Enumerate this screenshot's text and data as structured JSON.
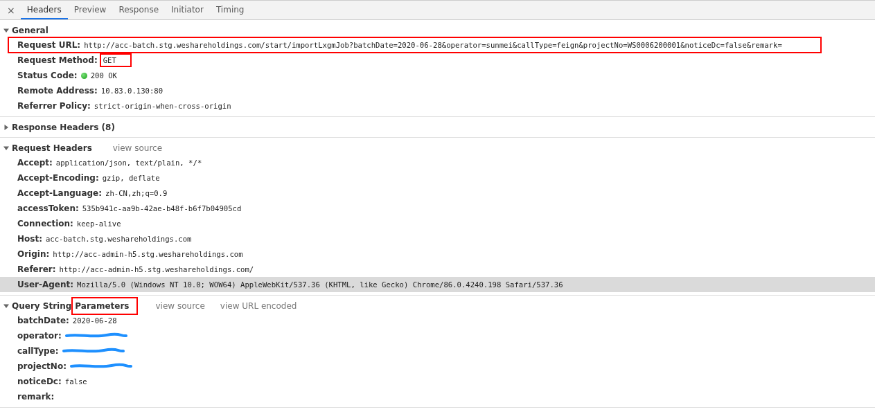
{
  "tabs": [
    {
      "label": "Headers",
      "selected": true
    },
    {
      "label": "Preview",
      "selected": false
    },
    {
      "label": "Response",
      "selected": false
    },
    {
      "label": "Initiator",
      "selected": false
    },
    {
      "label": "Timing",
      "selected": false
    }
  ],
  "close_button": "×",
  "sections": [
    {
      "title_parts": [
        {
          "text": "General",
          "highlighted": false
        }
      ],
      "expanded": true,
      "rows": [
        {
          "key": "Request URL:",
          "value": "http://acc-batch.stg.weshareholdings.com/start/importLxgmJob?batchDate=2020-06-28&operator=sunmei&callType=feign&projectNo=WS0006200001&noticeDc=false&remark=",
          "row_highlighted": true,
          "selected": false
        },
        {
          "key": "Request Method:",
          "value": "GET",
          "value_highlighted": true,
          "selected": false
        },
        {
          "key": "Status Code:",
          "value": "200 OK",
          "status_dot": true,
          "selected": false
        },
        {
          "key": "Remote Address:",
          "value": "10.83.0.130:80",
          "selected": false
        },
        {
          "key": "Referrer Policy:",
          "value": "strict-origin-when-cross-origin",
          "selected": false
        }
      ]
    },
    {
      "title_parts": [
        {
          "text": "Response Headers (8)",
          "highlighted": false
        }
      ],
      "expanded": false
    },
    {
      "title_parts": [
        {
          "text": "Request Headers",
          "highlighted": false
        }
      ],
      "expanded": true,
      "links": [
        "view source"
      ],
      "rows": [
        {
          "key": "Accept:",
          "value": "application/json, text/plain, */*",
          "selected": false
        },
        {
          "key": "Accept-Encoding:",
          "value": "gzip, deflate",
          "selected": false
        },
        {
          "key": "Accept-Language:",
          "value": "zh-CN,zh;q=0.9",
          "selected": false
        },
        {
          "key": "accessToken:",
          "value": "535b941c-aa9b-42ae-b48f-b6f7b04905cd",
          "selected": false
        },
        {
          "key": "Connection:",
          "value": "keep-alive",
          "selected": false
        },
        {
          "key": "Host:",
          "value": "acc-batch.stg.weshareholdings.com",
          "selected": false
        },
        {
          "key": "Origin:",
          "value": "http://acc-admin-h5.stg.weshareholdings.com",
          "selected": false
        },
        {
          "key": "Referer:",
          "value": "http://acc-admin-h5.stg.weshareholdings.com/",
          "selected": false
        },
        {
          "key": "User-Agent:",
          "value": "Mozilla/5.0 (Windows NT 10.0; WOW64) AppleWebKit/537.36 (KHTML, like Gecko) Chrome/86.0.4240.198 Safari/537.36",
          "selected": true
        }
      ]
    },
    {
      "title_parts": [
        {
          "text": "Query String",
          "highlighted": false
        },
        {
          "text": "Parameters",
          "highlighted": true
        }
      ],
      "expanded": true,
      "links": [
        "view source",
        "view URL encoded"
      ],
      "rows": [
        {
          "key": "batchDate:",
          "value": "2020-06-28",
          "selected": false
        },
        {
          "key": "operator:",
          "redacted": true,
          "selected": false
        },
        {
          "key": "callType:",
          "redacted": true,
          "selected": false
        },
        {
          "key": "projectNo:",
          "redacted": true,
          "selected": false
        },
        {
          "key": "noticeDc:",
          "value": "false",
          "selected": false
        },
        {
          "key": "remark:",
          "selected": false
        }
      ]
    }
  ]
}
